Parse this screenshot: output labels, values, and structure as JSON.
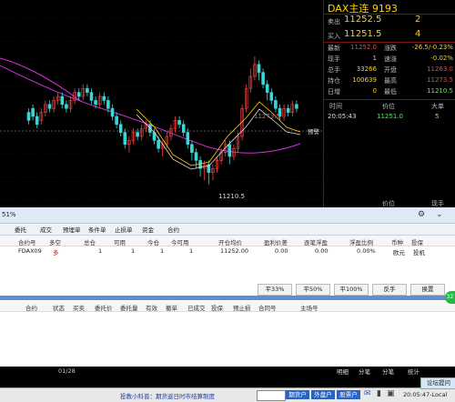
{
  "quote": {
    "title": "DAX主连 9193",
    "sell_label": "卖出",
    "sell_price": "11252.5",
    "sell_qty": "2",
    "buy_label": "买入",
    "buy_price": "11251.5",
    "buy_qty": "4",
    "stats": [
      {
        "l1": "最新",
        "v1": "11252.0",
        "l2": "涨跌",
        "v2": "-26.5/-0.23%"
      },
      {
        "l1": "现手",
        "v1": "1",
        "l2": "速涨",
        "v2": "-0.02%"
      },
      {
        "l1": "总手",
        "v1": "33266",
        "l2": "开盘",
        "v2": "11263.0"
      },
      {
        "l1": "持仓",
        "v1": "100639",
        "l2": "最高",
        "v2": "11273.5"
      },
      {
        "l1": "日增",
        "v1": "0",
        "l2": "最低",
        "v2": "11210.5"
      }
    ],
    "tick_head": [
      "时间",
      "价位",
      "大单"
    ],
    "tick_row": [
      "20:05:43",
      "11251.0",
      "5"
    ],
    "tick_head2": [
      "价位",
      "现手"
    ],
    "bottom_tabs": [
      "明细",
      "分笔",
      "分笔",
      "统计"
    ]
  },
  "chart": {
    "high_label": "11273.5",
    "low_label": "11210.5",
    "warn_label": "预警",
    "date_label": "01/28",
    "candles": [
      [
        12,
        8,
        14,
        6
      ],
      [
        14,
        10,
        16,
        8
      ],
      [
        10,
        6,
        12,
        4
      ],
      [
        8,
        12,
        14,
        6
      ],
      [
        12,
        16,
        18,
        10
      ],
      [
        16,
        14,
        18,
        12
      ],
      [
        14,
        18,
        20,
        12
      ],
      [
        18,
        20,
        22,
        16
      ],
      [
        20,
        16,
        22,
        14
      ],
      [
        16,
        14,
        18,
        12
      ],
      [
        14,
        18,
        20,
        12
      ],
      [
        18,
        22,
        24,
        16
      ],
      [
        22,
        20,
        24,
        18
      ],
      [
        20,
        24,
        26,
        18
      ],
      [
        24,
        22,
        26,
        20
      ],
      [
        22,
        18,
        24,
        16
      ],
      [
        18,
        16,
        20,
        14
      ],
      [
        16,
        20,
        22,
        14
      ],
      [
        20,
        18,
        22,
        16
      ],
      [
        18,
        14,
        20,
        12
      ],
      [
        14,
        10,
        16,
        8
      ],
      [
        10,
        6,
        12,
        4
      ],
      [
        6,
        2,
        8,
        0
      ],
      [
        2,
        -4,
        4,
        -6
      ],
      [
        -4,
        -2,
        0,
        -8
      ],
      [
        -2,
        2,
        4,
        -4
      ],
      [
        2,
        0,
        4,
        -2
      ],
      [
        0,
        4,
        6,
        -2
      ],
      [
        4,
        6,
        8,
        2
      ],
      [
        6,
        2,
        8,
        0
      ],
      [
        2,
        -2,
        4,
        -4
      ],
      [
        -2,
        -6,
        0,
        -8
      ],
      [
        -6,
        -4,
        -2,
        -10
      ],
      [
        -4,
        0,
        2,
        -6
      ],
      [
        0,
        4,
        6,
        -2
      ],
      [
        4,
        8,
        10,
        2
      ],
      [
        8,
        6,
        10,
        4
      ],
      [
        6,
        2,
        8,
        0
      ],
      [
        2,
        -4,
        4,
        -6
      ],
      [
        -4,
        -8,
        -2,
        -12
      ],
      [
        -8,
        -12,
        -6,
        -16
      ],
      [
        -12,
        -16,
        -10,
        -20
      ],
      [
        -16,
        -14,
        -12,
        -22
      ],
      [
        -14,
        -18,
        -12,
        -24
      ],
      [
        -18,
        -16,
        -14,
        -22
      ],
      [
        -16,
        -12,
        -10,
        -18
      ],
      [
        -12,
        -8,
        -6,
        -14
      ],
      [
        -8,
        -4,
        -2,
        -10
      ],
      [
        -4,
        -10,
        -2,
        -14
      ],
      [
        -10,
        -6,
        -4,
        -12
      ],
      [
        -6,
        0,
        2,
        -8
      ],
      [
        0,
        14,
        16,
        -2
      ],
      [
        14,
        24,
        26,
        12
      ],
      [
        24,
        30,
        34,
        22
      ],
      [
        30,
        36,
        40,
        28
      ],
      [
        36,
        32,
        38,
        28
      ],
      [
        32,
        26,
        34,
        24
      ],
      [
        26,
        22,
        28,
        18
      ],
      [
        22,
        18,
        24,
        16
      ],
      [
        18,
        14,
        20,
        12
      ],
      [
        14,
        10,
        16,
        8
      ],
      [
        10,
        14,
        16,
        8
      ],
      [
        14,
        12,
        16,
        10
      ],
      [
        12,
        16,
        18,
        10
      ],
      [
        16,
        14,
        18,
        12
      ]
    ]
  },
  "panel": {
    "percent": "51%",
    "tabs": [
      "委托",
      "成交",
      "预埋单",
      "条件单",
      "止损单",
      "资金",
      "合约"
    ],
    "columns": [
      "合约号",
      "多空",
      "总仓",
      "可用",
      "今仓",
      "今可用",
      "开仓均价",
      "盈利价差",
      "逐笔浮盈",
      "浮盈比例",
      "币种",
      "投保"
    ],
    "row": [
      "FDAX09",
      "多",
      "1",
      "1",
      "1",
      "1",
      "11252.00",
      "0.00",
      "0.00",
      "0.00%",
      "欧元",
      "投机"
    ],
    "buttons": [
      "平33%",
      "平50%",
      "平100%",
      "反手",
      "换置"
    ],
    "columns2": [
      "合约",
      "状态",
      "买卖",
      "委托价",
      "委托量",
      "有效",
      "撤单",
      "已成交",
      "投保",
      "预止损",
      "合同号",
      "主场号"
    ],
    "badge": "32"
  },
  "status": {
    "ticker": "投教小科普：期货返日时市结算制度",
    "buttons": [
      "期货户",
      "外盘户",
      "股票户"
    ],
    "time": "20:05:47-Local",
    "forum": "论坛提问"
  }
}
